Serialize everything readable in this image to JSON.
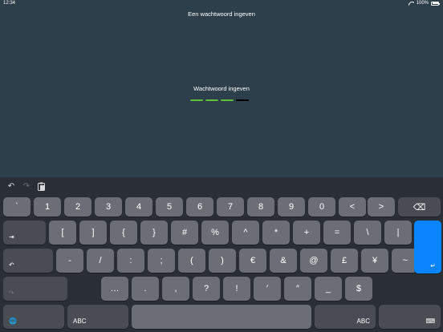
{
  "status": {
    "time": "12:34",
    "battery": "100%"
  },
  "screen": {
    "title": "Een wachtwoord ingeven",
    "password_label": "Wachtwoord ingeven",
    "password_dashes": [
      {
        "color": "#5fbf3a"
      },
      {
        "color": "#5fbf3a"
      },
      {
        "color": "#5fbf3a"
      },
      {
        "color": "#000000"
      }
    ]
  },
  "keyboard": {
    "shortcuts": {
      "undo": "↶",
      "redo": "↷",
      "paste": "📋"
    },
    "row1": [
      "`",
      "1",
      "2",
      "3",
      "4",
      "5",
      "6",
      "7",
      "8",
      "9",
      "0",
      "<",
      ">"
    ],
    "row2": [
      "[",
      "]",
      "{",
      "}",
      "#",
      "%",
      "^",
      "*",
      "+",
      "=",
      "\\",
      "|"
    ],
    "row3": [
      "-",
      "/",
      ":",
      ";",
      "(",
      ")",
      "€",
      "&",
      "@",
      "£",
      "¥",
      "~"
    ],
    "row4": [
      "…",
      ".",
      ",",
      "?",
      "!",
      "′",
      "″",
      "_",
      "$"
    ],
    "abc_left": "ABC",
    "abc_right": "ABC",
    "delete_icon": "⌫",
    "tab_icon": "⇥",
    "undo_key_icon": "↶",
    "redo_key_icon": "↷",
    "return_icon": "↵",
    "globe_icon": "🌐",
    "hide_keyboard_icon": "⌨"
  }
}
